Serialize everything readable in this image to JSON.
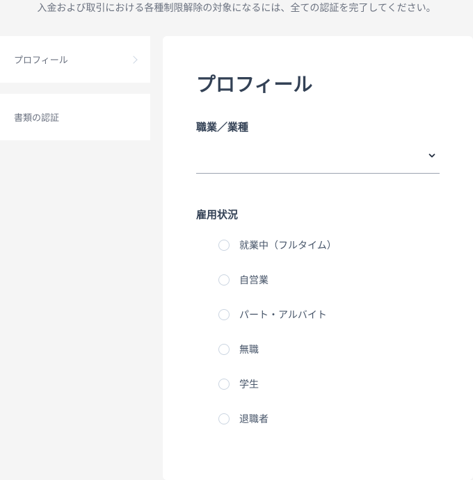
{
  "header": {
    "notice": "入金および取引における各種制限解除の対象になるには、全ての認証を完了してください。"
  },
  "sidebar": {
    "items": [
      {
        "label": "プロフィール",
        "active": true
      },
      {
        "label": "書類の認証",
        "active": false
      }
    ]
  },
  "main": {
    "title": "プロフィール",
    "fields": {
      "occupation": {
        "label": "職業／業種",
        "value": ""
      },
      "employment": {
        "label": "雇用状況",
        "options": [
          "就業中（フルタイム）",
          "自営業",
          "パート・アルバイト",
          "無職",
          "学生",
          "退職者"
        ]
      }
    }
  }
}
